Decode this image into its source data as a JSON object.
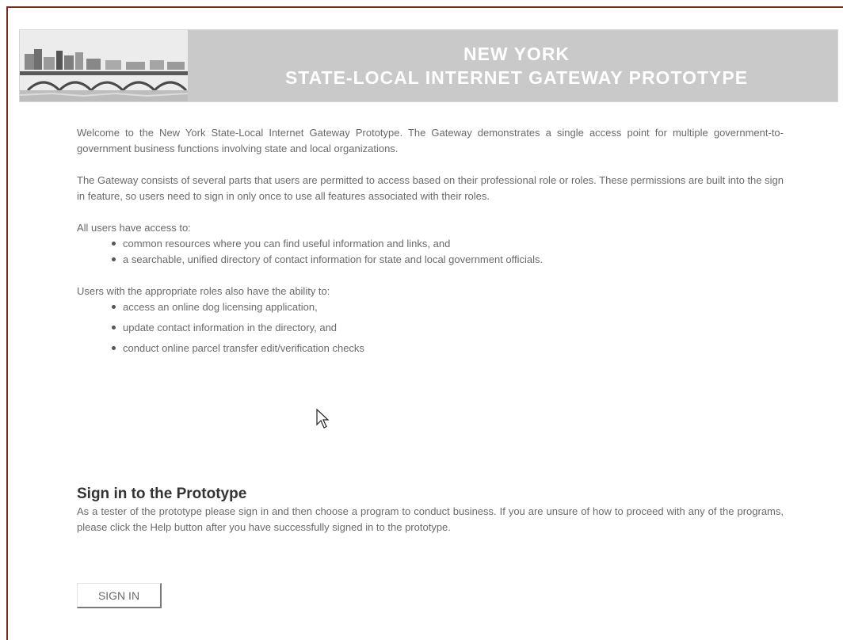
{
  "banner": {
    "title_line1": "NEW YORK",
    "title_line2": "STATE-LOCAL INTERNET GATEWAY PROTOTYPE",
    "photo_icon": "bridge-photo"
  },
  "intro": {
    "p1": "Welcome to the New York State-Local Internet Gateway Prototype. The Gateway demonstrates a single access point for multiple government-to-government business functions involving state and local organizations.",
    "p2": "The Gateway consists of several parts that users are permitted to access based on their professional role or roles. These permissions are built into the sign in feature, so users need to sign in only once to use all features associated with their roles."
  },
  "all_users": {
    "intro": "All users have access to:",
    "items": [
      "common resources where you can find useful information and links, and",
      "a searchable, unified directory of contact information for state and local government officials."
    ]
  },
  "role_users": {
    "intro": "Users with the appropriate roles also have the ability to:",
    "items": [
      "access an online dog licensing application,",
      "update contact information in the directory, and",
      "conduct online parcel transfer edit/verification checks"
    ]
  },
  "signin": {
    "heading": "Sign in to the Prototype",
    "text": "As a tester of the prototype please sign in and then choose a program to conduct business. If you are unsure of how to proceed with any of the programs, please click the Help button after you have successfully signed in to the prototype.",
    "button_label": "SIGN IN"
  },
  "colors": {
    "frame_border": "#6e2f22",
    "banner_bg": "#c9c9c9",
    "banner_text": "#ffffff",
    "body_text": "#6a6a6a"
  }
}
